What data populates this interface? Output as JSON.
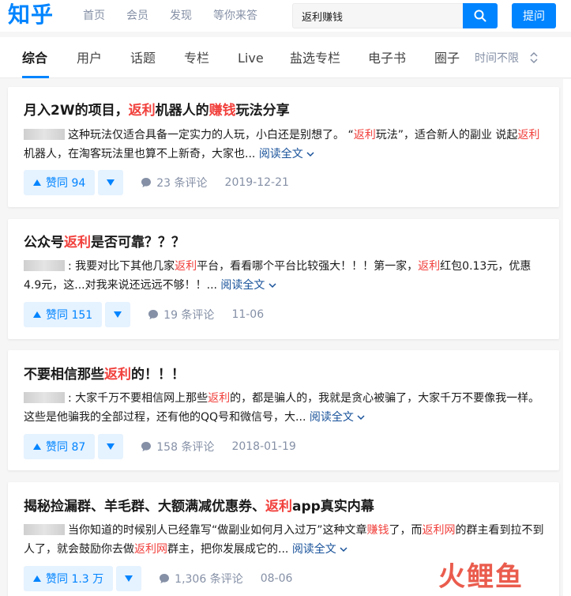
{
  "header": {
    "logo": "知乎",
    "nav": [
      "首页",
      "会员",
      "发现",
      "等你来答"
    ],
    "search_value": "返利赚钱",
    "ask_label": "提问"
  },
  "tabs": [
    "综合",
    "用户",
    "话题",
    "专栏",
    "Live",
    "盐选专栏",
    "电子书",
    "圈子"
  ],
  "time_filter": "时间不限",
  "cards": [
    {
      "title": [
        "月入2W的项目，",
        "返利",
        "机器人的",
        "赚钱",
        "玩法分享"
      ],
      "excerpt": [
        "这种玩法仅适合具备一定实力的人玩，小白还是别想了。 “",
        "返利",
        "玩法”，适合新人的副业 说起",
        "返利",
        "机器人，在淘客玩法里也算不上新奇，大家也... "
      ],
      "read_more": "阅读全文",
      "votes": "赞同 94",
      "comments": "23 条评论",
      "date": "2019-12-21"
    },
    {
      "title": [
        "公众号",
        "返利",
        "是否可靠？？？"
      ],
      "excerpt": [
        ": 我要对比下其他几家",
        "返利",
        "平台，看看哪个平台比较强大！！！第一家，",
        "返利",
        "红包0.13元，优惠4.9元，这...对我来说还远远不够！！... "
      ],
      "read_more": "阅读全文",
      "votes": "赞同 151",
      "comments": "19 条评论",
      "date": "11-06"
    },
    {
      "title": [
        "不要相信那些",
        "返利",
        "的！！！"
      ],
      "excerpt": [
        ": 大家千万不要相信网上那些",
        "返利",
        "的，都是骗人的，我就是贪心被骗了，大家千万不要像我一样。这些是他骗我的全部过程，还有他的QQ号和微信号，大... "
      ],
      "read_more": "阅读全文",
      "votes": "赞同 87",
      "comments": "158 条评论",
      "date": "2018-01-19"
    },
    {
      "title": [
        "揭秘捡漏群、羊毛群、大额满减优惠券、",
        "返利",
        "app真实内幕"
      ],
      "excerpt": [
        "当你知道的时候别人已经靠写“做副业如何月入过万”这种文章",
        "赚钱",
        "了，而",
        "返利网",
        "的群主看到拉不到人了，就会鼓励你去做",
        "返利网",
        "群主，把你发展成它的... "
      ],
      "read_more": "阅读全文",
      "votes": "赞同 1.3 万",
      "comments": "1,306 条评论",
      "date": "08-06"
    }
  ],
  "watermark": "火鲤鱼",
  "colors": {
    "brand": "#0084ff",
    "highlight": "#f1403c",
    "link": "#175199",
    "muted": "#8590a6"
  }
}
